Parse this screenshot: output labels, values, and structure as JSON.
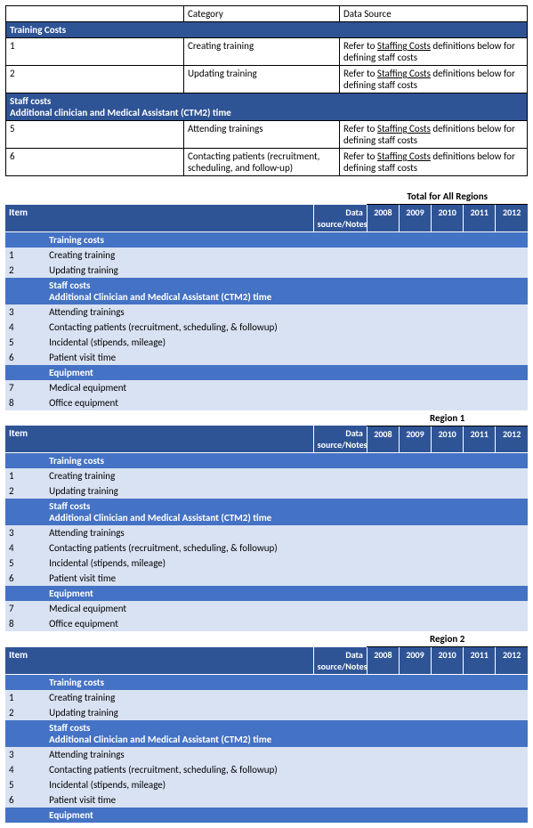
{
  "top_table": {
    "headers": {
      "blank": "",
      "category": "Category",
      "data_source": "Data Source"
    },
    "section1": {
      "title": "Training Costs"
    },
    "rows1": [
      {
        "num": "1",
        "category": "Creating training",
        "source_prefix": "Refer to ",
        "source_link": "Staffing Costs",
        "source_suffix": " definitions below for defining staff costs"
      },
      {
        "num": "2",
        "category": "Updating training",
        "source_prefix": "Refer to ",
        "source_link": "Staffing Costs",
        "source_suffix": " definitions below for defining staff costs"
      }
    ],
    "section2": {
      "title_line1": "Staff costs",
      "title_line2": "Additional clinician and Medical Assistant (CTM2) time"
    },
    "rows2": [
      {
        "num": "5",
        "category": "Attending trainings",
        "source_prefix": "Refer to ",
        "source_link": "Staffing Costs",
        "source_suffix": " definitions below for defining staff costs"
      },
      {
        "num": "6",
        "category": "Contacting patients (recruitment, scheduling, and follow-up)",
        "source_prefix": "Refer to ",
        "source_link": "Staffing Costs",
        "source_suffix": " definitions below for defining staff costs"
      }
    ]
  },
  "headers": {
    "item": "Item",
    "data_source": "Data source/Notes",
    "years": [
      "2008",
      "2009",
      "2010",
      "2011",
      "2012"
    ]
  },
  "sections": {
    "training": "Training costs",
    "staff_line1": "Staff costs",
    "staff_line2": "Additional Clinician and Medical Assistant (CTM2) time",
    "equipment": "Equipment"
  },
  "rows": {
    "r1": {
      "num": "1",
      "desc": "Creating training"
    },
    "r2": {
      "num": "2",
      "desc": "Updating training"
    },
    "r3": {
      "num": "3",
      "desc": "Attending trainings"
    },
    "r4": {
      "num": "4",
      "desc": "Contacting patients (recruitment, scheduling, & followup)"
    },
    "r5": {
      "num": "5",
      "desc": "Incidental (stipends, mileage)"
    },
    "r6": {
      "num": "6",
      "desc": "Patient visit time"
    },
    "r7": {
      "num": "7",
      "desc": "Medical equipment"
    },
    "r8": {
      "num": "8",
      "desc": "Office equipment"
    }
  },
  "regions": {
    "all": "Total for All Regions",
    "r1": "Region 1",
    "r2": "Region 2"
  }
}
